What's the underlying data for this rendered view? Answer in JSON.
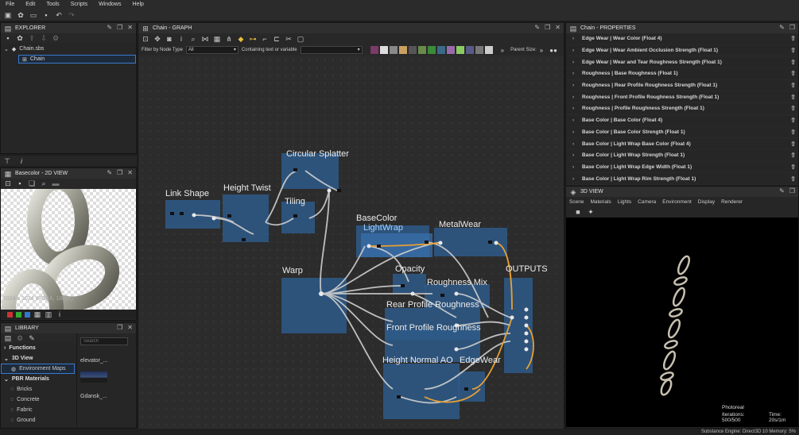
{
  "menu": [
    "File",
    "Edit",
    "Tools",
    "Scripts",
    "Windows",
    "Help"
  ],
  "explorer": {
    "title": "EXPLORER",
    "package": "Chain.sbs",
    "graph": "Chain"
  },
  "view2d": {
    "title": "Basecolor - 2D VIEW",
    "overlay": "1024 x 1024 (RGBA, 16bpc)"
  },
  "library": {
    "title": "LIBRARY",
    "search_placeholder": "Search",
    "categories": [
      "Functions",
      "3D View",
      "PBR Materials"
    ],
    "items_3d": [
      "Environment Maps"
    ],
    "items_pbr": [
      "Bricks",
      "Concrete",
      "Fabric",
      "Ground"
    ],
    "thumbs": [
      "elevator_...",
      "Gdansk_..."
    ]
  },
  "graph": {
    "title": "Chain - GRAPH",
    "filter_label": "Filter by Node Type",
    "filter_value": "All",
    "text_label": "Containing text or variable",
    "parent_size_label": "Parent Size:",
    "frames": [
      "Link Shape",
      "Height Twist",
      "Circular Splatter",
      "Tiling",
      "Warp",
      "BaseColor",
      "LightWrap",
      "MetalWear",
      "Opacity",
      "Roughness Mix",
      "OUTPUTS",
      "Rear Profile Roughness",
      "Front Profile Roughness",
      "Height Normal AO",
      "EdgeWear"
    ]
  },
  "properties": {
    "title": "Chain - PROPERTIES",
    "rows": [
      "Edge Wear | Wear Color (Float 4)",
      "Edge Wear | Wear Ambient Occlusion Strength (Float 1)",
      "Edge Wear | Wear and Tear Roughness Strength (Float 1)",
      "Roughness | Base Roughness (Float 1)",
      "Roughness | Rear Profile  Roughness Strength (Float 1)",
      "Roughness | Front Profile  Roughness Strength (Float 1)",
      "Roughness | Profile Roughness Strength (Float 1)",
      "Base Color | Base Color  (Float 4)",
      "Base Color | Base Color Strength (Float 1)",
      "Base Color | Light Wrap Base Color (Float 4)",
      "Base Color | Light Wrap Strength (Float 1)",
      "Base Color | Light Wrap Edge Width (Float 1)",
      "Base Color | Light Wrap Rim Strength (Float 1)"
    ]
  },
  "view3d": {
    "title": "3D VIEW",
    "menu": [
      "Scene",
      "Materials",
      "Lights",
      "Camera",
      "Environment",
      "Display",
      "Renderer"
    ],
    "mode": "Photoreal",
    "iterations": "Iterations: 500/500",
    "time": "Time: 20s/1m"
  },
  "status": "Substance Engine: Direct3D 10   Memory: 5%"
}
